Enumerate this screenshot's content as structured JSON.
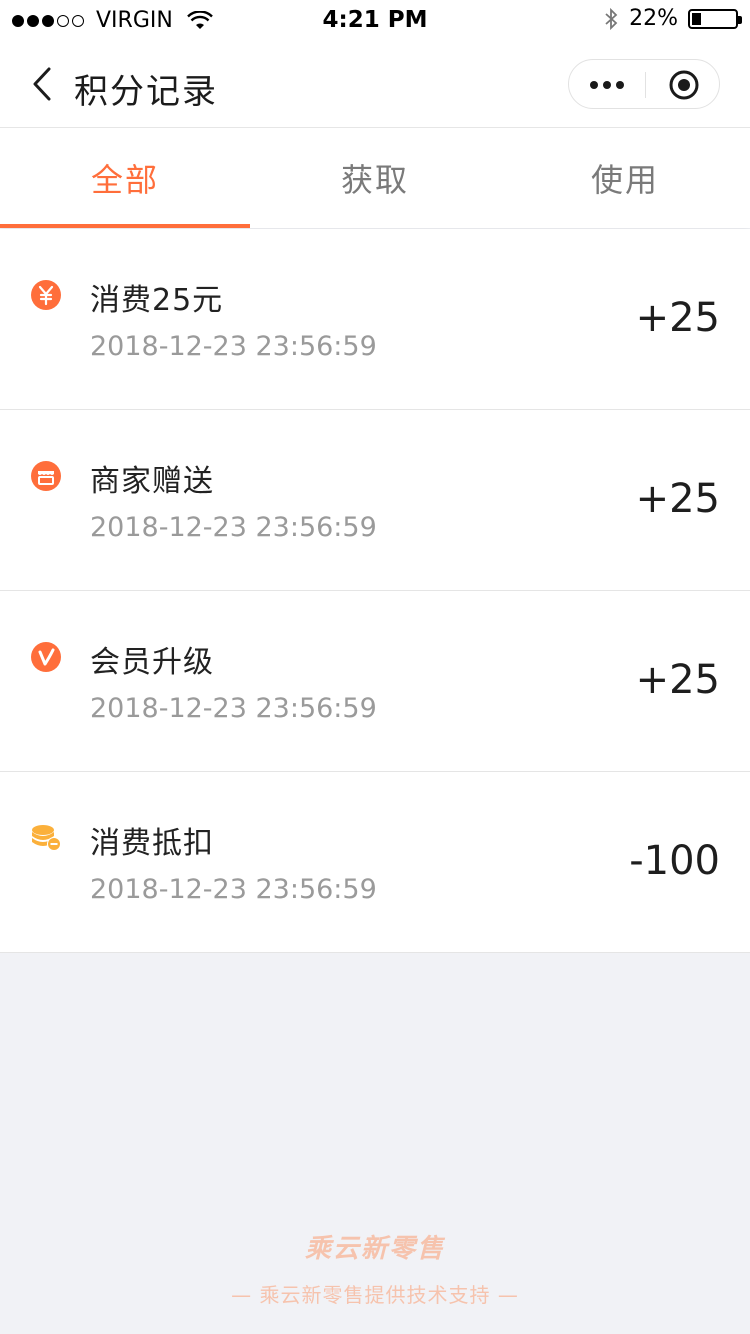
{
  "status_bar": {
    "carrier": "VIRGIN",
    "time": "4:21 PM",
    "battery_text": "22%",
    "battery_level": 0.22
  },
  "nav": {
    "title": "积分记录"
  },
  "tabs": [
    {
      "label": "全部",
      "active": true
    },
    {
      "label": "获取",
      "active": false
    },
    {
      "label": "使用",
      "active": false
    }
  ],
  "records": [
    {
      "icon": "yuan-icon",
      "title": "消费25元",
      "time": "2018-12-23 23:56:59",
      "amount": "+25"
    },
    {
      "icon": "store-icon",
      "title": "商家赠送",
      "time": "2018-12-23 23:56:59",
      "amount": "+25"
    },
    {
      "icon": "vip-icon",
      "title": "会员升级",
      "time": "2018-12-23 23:56:59",
      "amount": "+25"
    },
    {
      "icon": "coins-minus-icon",
      "title": "消费抵扣",
      "time": "2018-12-23 23:56:59",
      "amount": "-100"
    }
  ],
  "footer": {
    "logo": "乘云新零售",
    "support_text": "— 乘云新零售提供技术支持 —"
  },
  "colors": {
    "accent": "#ff6e3b",
    "icon_yellow": "#fbb03b",
    "footer_text": "#f6c3ad"
  }
}
